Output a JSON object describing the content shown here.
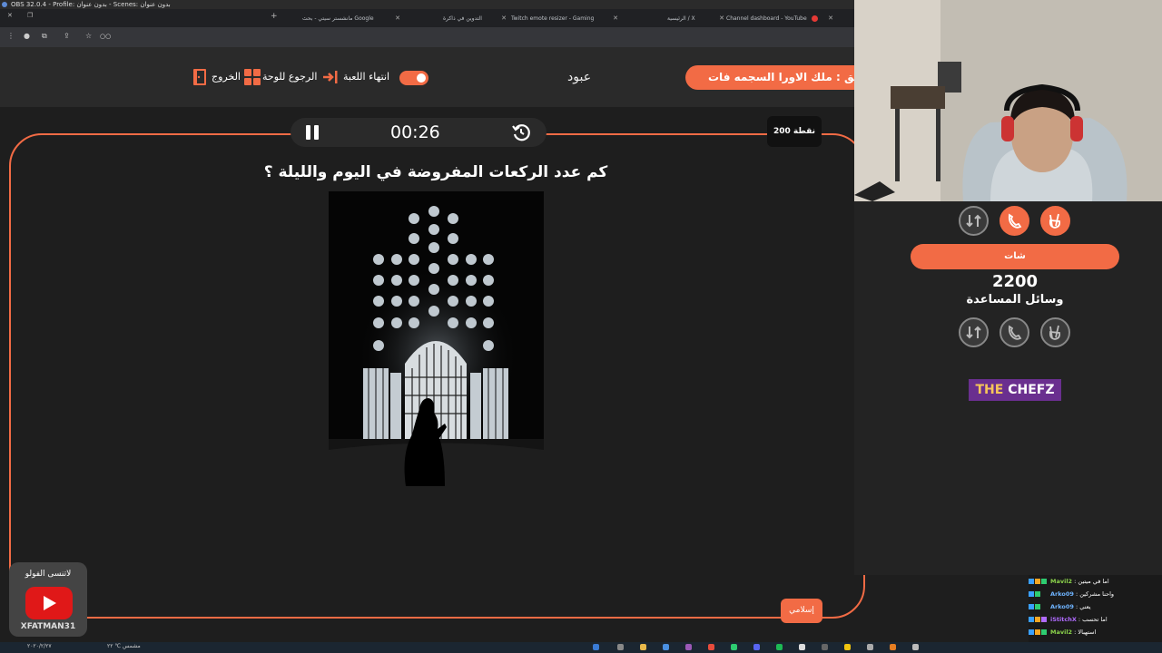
{
  "obs": {
    "title": "OBS 32.0.4 - Profile: بدون عنوان - Scenes: بدون عنوان"
  },
  "browser": {
    "tabs": [
      {
        "label": "Channel dashboard - YouTube",
        "color": "#e53935"
      },
      {
        "label": "الرئيسية / X",
        "color": "#ffffff"
      },
      {
        "label": "Twitch emote resizer - Gaming",
        "color": "#e84a5f"
      },
      {
        "label": "التدوين في ذاكرة",
        "color": "#9e9e9e"
      },
      {
        "label": "مانشستر سيتي - بحث Google",
        "color": "#4285f4"
      }
    ],
    "address": "○○"
  },
  "header": {
    "team": "فريق : ملك الاورا السجمه فات",
    "player": "عبود",
    "end_game": "انتهاء اللعبة",
    "back_to_board": "الرجوع للوحة",
    "exit": "الخروج"
  },
  "game": {
    "timer": "00:26",
    "points": "200 نقطة",
    "question": "كم عدد الركعات المفروضة في اليوم والليلة ؟",
    "category": "إسلامي"
  },
  "side": {
    "chat": "شات",
    "score": "2200",
    "help_label": "وسائل المساعدة",
    "sponsor_the": "THE",
    "sponsor_chefz": "CHEFZ"
  },
  "youtube_card": {
    "label": "لاتنسى الفولو",
    "handle": "XFATMAN31"
  },
  "chat_messages": [
    {
      "user": "Mavil2",
      "text": "اما في ميتين",
      "color": "#8bd34b"
    },
    {
      "user": "Arko09",
      "text": "واحنا مشركين",
      "color": "#6fb4ff"
    },
    {
      "user": "Arko09",
      "text": "يعني",
      "color": "#6fb4ff"
    },
    {
      "user": "iStitchX",
      "text": "اما تحسب",
      "color": "#b06bff"
    },
    {
      "user": "Mavil2",
      "text": "استهبالا",
      "color": "#8bd34b"
    }
  ],
  "taskbar": {
    "weather": "مشمس ℃ ۲۲",
    "date": "۲۰۲۰/۲/۲۷"
  }
}
